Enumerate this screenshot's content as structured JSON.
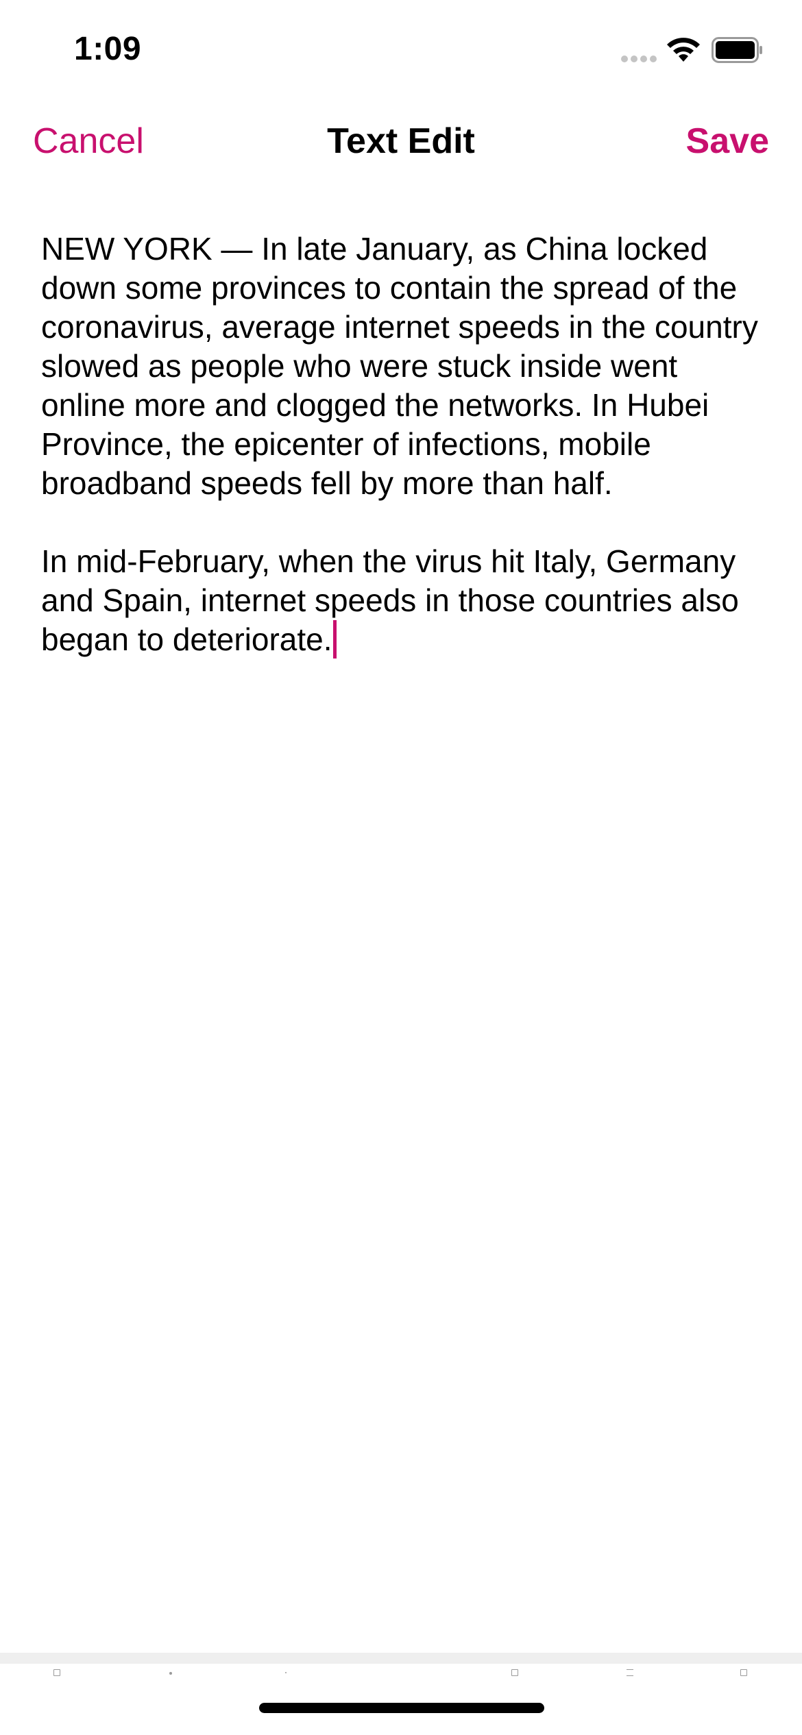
{
  "status_bar": {
    "time": "1:09",
    "icons": [
      "cellular-signal-icon",
      "wifi-icon",
      "battery-icon"
    ]
  },
  "nav": {
    "cancel_label": "Cancel",
    "title": "Text Edit",
    "save_label": "Save"
  },
  "editor": {
    "paragraphs": [
      "NEW YORK — In late January, as China locked down some provinces to contain the spread of the coronavirus, average internet speeds in the country slowed as people who were stuck inside went online more and clogged the networks. In Hubei Province, the epicenter of infections, mobile broadband speeds fell by more than half.",
      "In mid-February, when the virus hit Italy, Germany and Spain, internet speeds in those countries also began to deteriorate."
    ]
  },
  "colors": {
    "accent": "#c8106e",
    "text": "#000000",
    "background": "#ffffff"
  }
}
